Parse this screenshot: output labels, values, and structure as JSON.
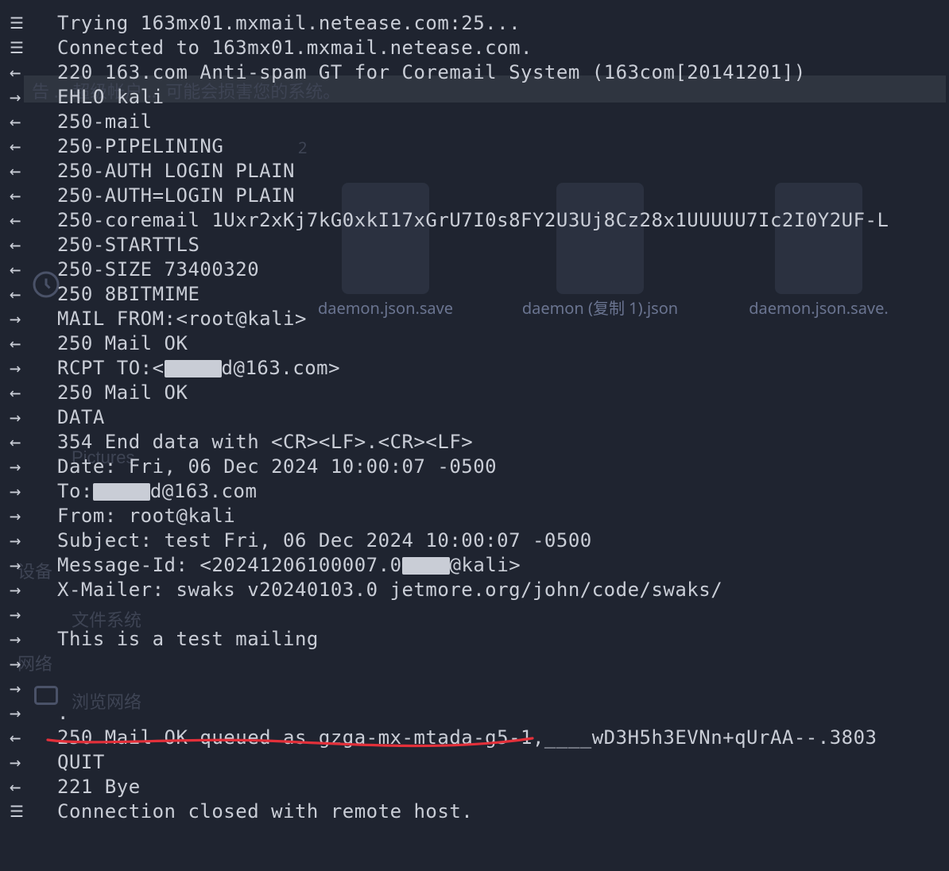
{
  "background": {
    "banner_hint": "告 ... 超级帐户 ... 可能会损害您的系统。",
    "labels": {
      "settings": "设备",
      "pictures": "Pictures",
      "filesystem": "文件系统",
      "network": "网络",
      "browse_network": "浏览网络"
    },
    "files": [
      "daemon.json.save",
      "daemon (复制 1).json",
      "daemon.json.save."
    ],
    "count_badge": "2"
  },
  "terminal": {
    "lines": [
      {
        "p": "===",
        "t": "Trying 163mx01.mxmail.netease.com:25..."
      },
      {
        "p": "===",
        "t": "Connected to 163mx01.mxmail.netease.com."
      },
      {
        "p": "<-",
        "t": "220 163.com Anti-spam GT for Coremail System (163com[20141201])"
      },
      {
        "p": "->",
        "t": "EHLO kali"
      },
      {
        "p": "<-",
        "t": "250-mail"
      },
      {
        "p": "<-",
        "t": "250-PIPELINING"
      },
      {
        "p": "<-",
        "t": "250-AUTH LOGIN PLAIN"
      },
      {
        "p": "<-",
        "t": "250-AUTH=LOGIN PLAIN"
      },
      {
        "p": "<-",
        "t": "250-coremail 1Uxr2xKj7kG0xkI17xGrU7I0s8FY2U3Uj8Cz28x1UUUUU7Ic2I0Y2UF-L"
      },
      {
        "p": "<-",
        "t": "250-STARTTLS"
      },
      {
        "p": "<-",
        "t": "250-SIZE 73400320"
      },
      {
        "p": "<-",
        "t": "250 8BITMIME"
      },
      {
        "p": "->",
        "t": "MAIL FROM:<root@kali>"
      },
      {
        "p": "<-",
        "t": "250 Mail OK"
      },
      {
        "p": "->",
        "t": "RCPT TO:<",
        "redact": "xxxxxx",
        "t2": "d@163.com>"
      },
      {
        "p": "<-",
        "t": "250 Mail OK"
      },
      {
        "p": "->",
        "t": "DATA"
      },
      {
        "p": "<-",
        "t": "354 End data with <CR><LF>.<CR><LF>"
      },
      {
        "p": "->",
        "t": "Date: Fri, 06 Dec 2024 10:00:07 -0500"
      },
      {
        "p": "->",
        "t": "To: ",
        "redact": "xxxxxx",
        "t2": "d@163.com"
      },
      {
        "p": "->",
        "t": "From: root@kali"
      },
      {
        "p": "->",
        "t": "Subject: test Fri, 06 Dec 2024 10:00:07 -0500"
      },
      {
        "p": "->",
        "t": "Message-Id: <20241206100007.0",
        "redact": "xxxxx",
        "t2": "@kali>"
      },
      {
        "p": "->",
        "t": "X-Mailer: swaks v20240103.0 jetmore.org/john/code/swaks/"
      },
      {
        "p": "->",
        "t": ""
      },
      {
        "p": "->",
        "t": "This is a test mailing"
      },
      {
        "p": "->",
        "t": ""
      },
      {
        "p": "->",
        "t": ""
      },
      {
        "p": "->",
        "t": "."
      },
      {
        "p": "<-",
        "t": "250 Mail OK queued as gzga-mx-mtada-g5-1,____wD3H5h3EVNn+qUrAA--.3803"
      },
      {
        "p": "->",
        "t": "QUIT"
      },
      {
        "p": "<-",
        "t": "221 Bye"
      },
      {
        "p": "===",
        "t": "Connection closed with remote host."
      }
    ]
  }
}
